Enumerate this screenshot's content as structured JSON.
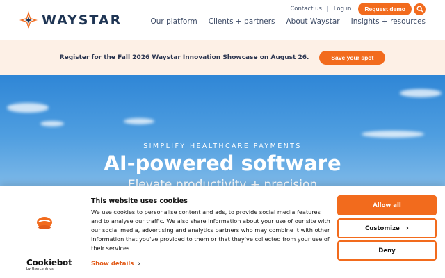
{
  "header": {
    "logo_text": "WAYSTAR",
    "util_links": [
      "Contact us",
      "Log in"
    ],
    "request_demo": "Request demo",
    "nav": [
      "Our platform",
      "Clients + partners",
      "About Waystar",
      "Insights + resources"
    ]
  },
  "banner": {
    "text": "Register for the Fall 2026 Waystar Innovation Showcase on August 26.",
    "button": "Save your spot"
  },
  "hero": {
    "eyebrow": "SIMPLIFY HEALTHCARE PAYMENTS",
    "title": "AI-powered software",
    "subtitle": "Elevate productivity + precision"
  },
  "cookie": {
    "title": "This website uses cookies",
    "body": "We use cookies to personalise content and ads, to provide social media features and to analyse our traffic. We also share information about your use of our site with our social media, advertising and analytics partners who may combine it with other information that you've provided to them or that they've collected from your use of their services.",
    "show_details": "Show details",
    "allow_all": "Allow all",
    "customize": "Customize",
    "deny": "Deny",
    "brand": "Cookiebot",
    "brand_by": "by Usercentrics"
  },
  "colors": {
    "accent": "#f26b1d",
    "navy": "#1f3554",
    "banner_bg": "#fdf0e6"
  },
  "icons": [
    "waystar-star-logo-icon",
    "search-icon",
    "cookiebot-icon",
    "chevron-right-icon"
  ]
}
